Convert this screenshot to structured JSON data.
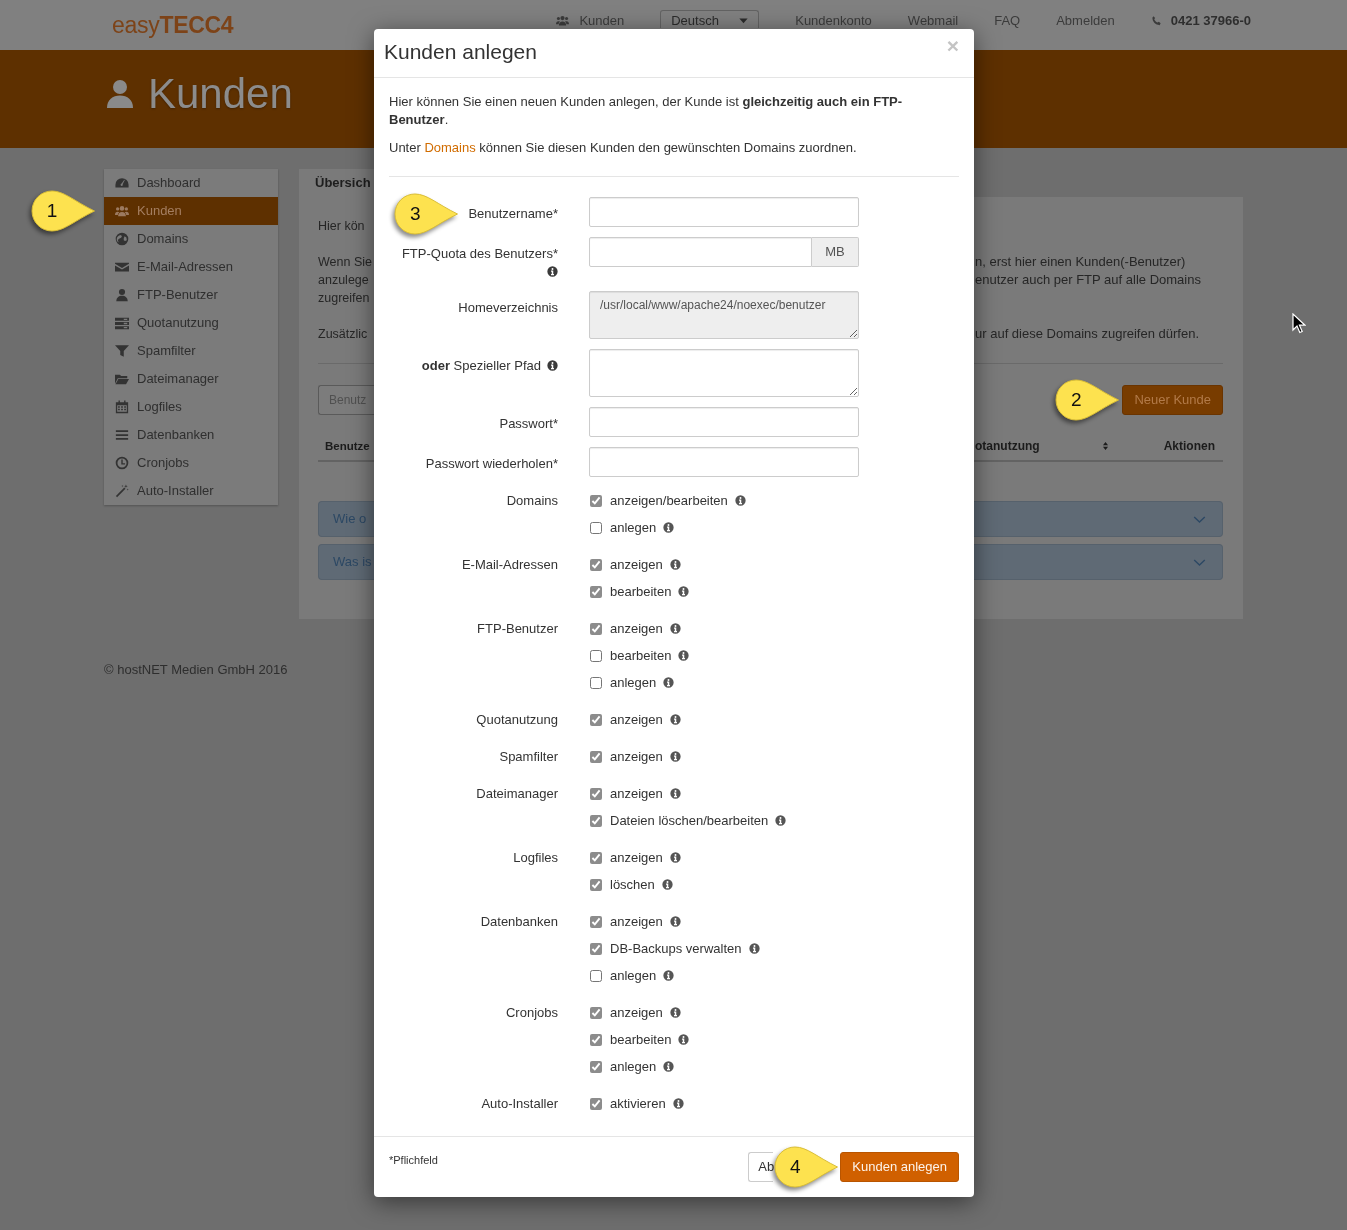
{
  "navbar": {
    "logo": "easy**TECC4**",
    "links": [
      {
        "label": "Kunden",
        "kind": "icon_link"
      },
      {
        "label": "Deutsch",
        "kind": "dropdown"
      },
      {
        "label": "Kundenkonto",
        "kind": "link"
      },
      {
        "label": "Webmail",
        "kind": "link"
      },
      {
        "label": "FAQ",
        "kind": "link"
      },
      {
        "label": "Abmelden",
        "kind": "link"
      },
      {
        "label": "0421 37966-0",
        "kind": "phone"
      }
    ]
  },
  "header": {
    "title": "Kunden"
  },
  "sidebar": {
    "items": [
      {
        "label": "Dashboard",
        "selected": false
      },
      {
        "label": "Kunden",
        "selected": true,
        "callout": "1"
      },
      {
        "label": "Domains",
        "selected": false
      },
      {
        "label": "E-Mail-Adressen",
        "selected": false
      },
      {
        "label": "FTP-Benutzer",
        "selected": false
      },
      {
        "label": "Quotanutzung",
        "selected": false
      },
      {
        "label": "Spamfilter",
        "selected": false
      },
      {
        "label": "Dateimanager",
        "selected": false
      },
      {
        "label": "Logfiles",
        "selected": false
      },
      {
        "label": "Datenbanken",
        "selected": false
      },
      {
        "label": "Cronjobs",
        "selected": false
      },
      {
        "label": "Auto-Installer",
        "selected": false
      }
    ]
  },
  "overview": {
    "tab": "Übersich",
    "paragraphs": [
      {
        "left": [
          "Hier kön"
        ]
      },
      {
        "left": [
          "Wenn Sie",
          "anzulege",
          "zugreifen"
        ],
        "right": [
          "n, erst hier einen Kunden(-Benutzer)",
          "enutzer auch per FTP auf alle Domains"
        ]
      },
      {
        "left": [
          "Zusätzlic"
        ],
        "right": [
          "ur auf diese Domains zugreifen dürfen."
        ]
      }
    ],
    "search": {
      "placeholder": "Benutz"
    },
    "new_button": {
      "label": "Neuer Kunde",
      "callout": "2"
    },
    "table": {
      "left_columns": [
        "Benutze"
      ],
      "right_columns": [
        {
          "label": "otanutzung",
          "sortable": true
        },
        {
          "label": "Aktionen",
          "sortable": false
        }
      ]
    },
    "faq": [
      {
        "title": "Wie o",
        "expanded": false
      },
      {
        "title": "Was is",
        "expanded": false
      }
    ]
  },
  "footer": {
    "copyright": "© hostNET Medien GmbH 2016"
  },
  "modal": {
    "title": "Kunden anlegen",
    "close": "×",
    "intro": "Hier können Sie einen neuen Kunden anlegen, der Kunde ist **gleichzeitig auch ein FTP-Benutzer**.",
    "domains_hint": {
      "before": "Unter",
      "link": "Domains",
      "after": "können Sie diesen Kunden den gewünschten Domains zuordnen."
    },
    "fields": [
      {
        "label": "Benutzername*",
        "kind": "text",
        "info": false,
        "callout": "3"
      },
      {
        "label": "FTP-Quota des Benutzers*",
        "kind": "text",
        "info": true,
        "addon": "MB"
      },
      {
        "label": "Homeverzeichnis",
        "kind": "textarea",
        "info": false,
        "readonly": true,
        "value": "/usr/local/www/apache24/noexec/benutzer"
      },
      {
        "label": "**oder** Spezieller Pfad",
        "kind": "textarea",
        "info": true,
        "readonly": false
      },
      {
        "label": "Passwort*",
        "kind": "password",
        "info": false
      },
      {
        "label": "Passwort wiederholen*",
        "kind": "password",
        "info": false
      }
    ],
    "permissions": [
      {
        "label": "Domains",
        "options": [
          {
            "label": "anzeigen/bearbeiten",
            "checked": true
          },
          {
            "label": "anlegen",
            "checked": false
          }
        ]
      },
      {
        "label": "E-Mail-Adressen",
        "options": [
          {
            "label": "anzeigen",
            "checked": true
          },
          {
            "label": "bearbeiten",
            "checked": true
          }
        ]
      },
      {
        "label": "FTP-Benutzer",
        "options": [
          {
            "label": "anzeigen",
            "checked": true
          },
          {
            "label": "bearbeiten",
            "checked": false
          },
          {
            "label": "anlegen",
            "checked": false
          }
        ]
      },
      {
        "label": "Quotanutzung",
        "options": [
          {
            "label": "anzeigen",
            "checked": true
          }
        ]
      },
      {
        "label": "Spamfilter",
        "options": [
          {
            "label": "anzeigen",
            "checked": true
          }
        ]
      },
      {
        "label": "Dateimanager",
        "options": [
          {
            "label": "anzeigen",
            "checked": true
          },
          {
            "label": "Dateien löschen/bearbeiten",
            "checked": true
          }
        ]
      },
      {
        "label": "Logfiles",
        "options": [
          {
            "label": "anzeigen",
            "checked": true
          },
          {
            "label": "löschen",
            "checked": true
          }
        ]
      },
      {
        "label": "Datenbanken",
        "options": [
          {
            "label": "anzeigen",
            "checked": true
          },
          {
            "label": "DB-Backups verwalten",
            "checked": true
          },
          {
            "label": "anlegen",
            "checked": false
          }
        ]
      },
      {
        "label": "Cronjobs",
        "options": [
          {
            "label": "anzeigen",
            "checked": true
          },
          {
            "label": "bearbeiten",
            "checked": true
          },
          {
            "label": "anlegen",
            "checked": true
          }
        ]
      },
      {
        "label": "Auto-Installer",
        "options": [
          {
            "label": "aktivieren",
            "checked": true
          }
        ]
      }
    ],
    "required_note": "*Pflichfeld",
    "buttons": [
      {
        "label": "Ab",
        "kind": "default"
      },
      {
        "label": "Kunden anlegen",
        "kind": "primary",
        "callout": "4"
      }
    ]
  }
}
